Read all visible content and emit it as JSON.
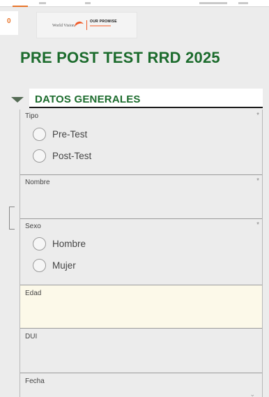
{
  "header": {
    "side_indicator": "0",
    "logo": {
      "world_vision": "World Vision",
      "our_promise": "OUR PROMISE"
    }
  },
  "form": {
    "title": "PRE POST TEST RRD 2025"
  },
  "section": {
    "title": "DATOS GENERALES"
  },
  "questions": {
    "tipo": {
      "label": "Tipo",
      "required": "*",
      "options": [
        "Pre-Test",
        "Post-Test"
      ]
    },
    "nombre": {
      "label": "Nombre",
      "required": "*",
      "value": ""
    },
    "sexo": {
      "label": "Sexo",
      "required": "*",
      "options": [
        "Hombre",
        "Mujer"
      ]
    },
    "edad": {
      "label": "Edad",
      "value": ""
    },
    "dui": {
      "label": "DUI",
      "value": ""
    },
    "fecha": {
      "label": "Fecha",
      "value": ""
    }
  },
  "icons": {
    "section_toggle": "caret-down-icon",
    "fecha_dropdown": "chevron-down-icon"
  },
  "colors": {
    "title_green": "#1b6b2c",
    "accent_orange": "#e8752a",
    "highlight_row": "#fcf9e9",
    "background": "#ececec"
  }
}
